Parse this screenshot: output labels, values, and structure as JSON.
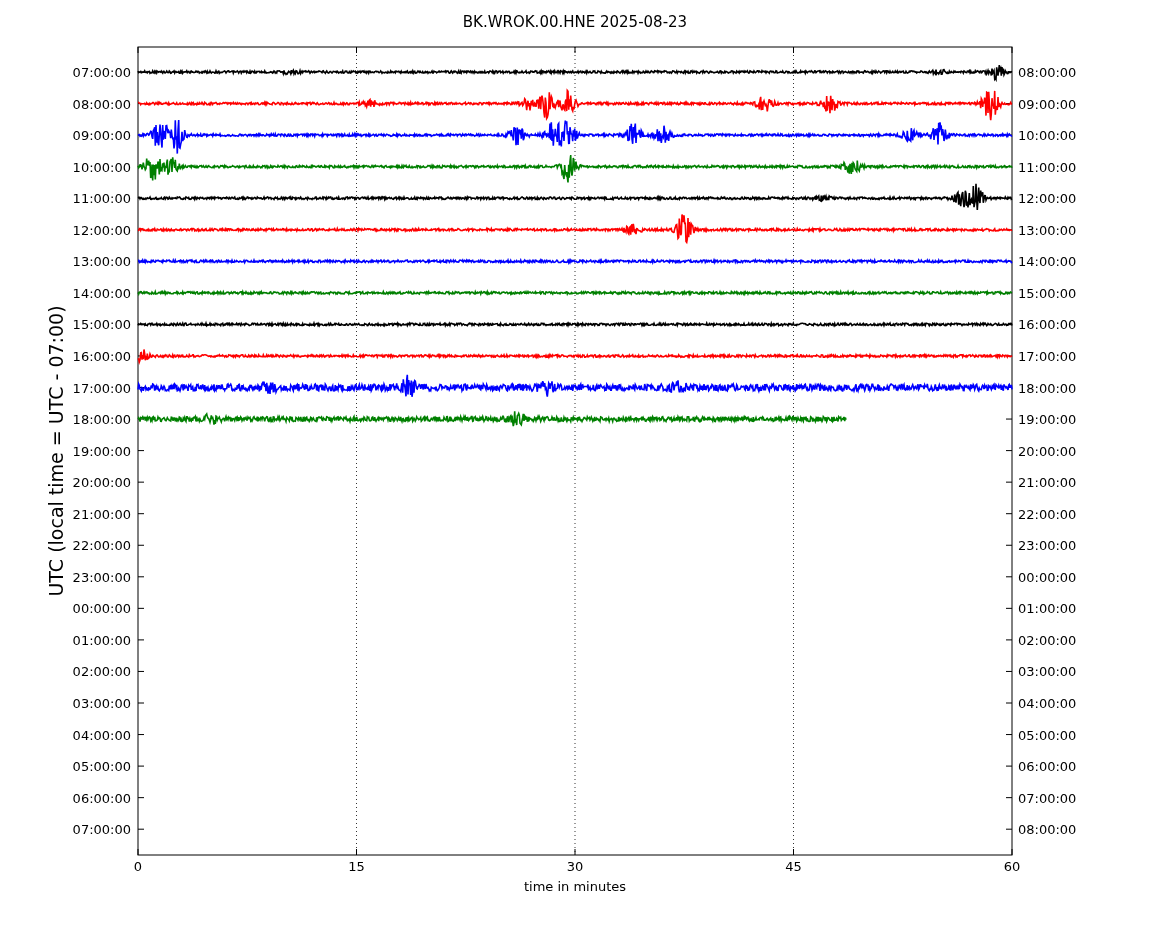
{
  "title": "BK.WROK.00.HNE 2025-08-23",
  "ylabel": "UTC (local time = UTC - 07:00)",
  "xlabel": "time in minutes",
  "xticks": [
    "0",
    "15",
    "30",
    "45",
    "60"
  ],
  "left_labels": [
    "07:00:00",
    "08:00:00",
    "09:00:00",
    "10:00:00",
    "11:00:00",
    "12:00:00",
    "13:00:00",
    "14:00:00",
    "15:00:00",
    "16:00:00",
    "17:00:00",
    "18:00:00",
    "19:00:00",
    "20:00:00",
    "21:00:00",
    "22:00:00",
    "23:00:00",
    "00:00:00",
    "01:00:00",
    "02:00:00",
    "03:00:00",
    "04:00:00",
    "05:00:00",
    "06:00:00",
    "07:00:00"
  ],
  "right_labels": [
    "08:00:00",
    "09:00:00",
    "10:00:00",
    "11:00:00",
    "12:00:00",
    "13:00:00",
    "14:00:00",
    "15:00:00",
    "16:00:00",
    "17:00:00",
    "18:00:00",
    "19:00:00",
    "20:00:00",
    "21:00:00",
    "22:00:00",
    "23:00:00",
    "00:00:00",
    "01:00:00",
    "02:00:00",
    "03:00:00",
    "04:00:00",
    "05:00:00",
    "06:00:00",
    "07:00:00",
    "08:00:00"
  ],
  "traces": [
    {
      "color": "#000000",
      "complete": true
    },
    {
      "color": "#ff0000",
      "complete": true
    },
    {
      "color": "#0000ff",
      "complete": true
    },
    {
      "color": "#008000",
      "complete": true
    },
    {
      "color": "#000000",
      "complete": true
    },
    {
      "color": "#ff0000",
      "complete": true
    },
    {
      "color": "#0000ff",
      "complete": true
    },
    {
      "color": "#008000",
      "complete": true
    },
    {
      "color": "#000000",
      "complete": true
    },
    {
      "color": "#ff0000",
      "complete": true
    },
    {
      "color": "#0000ff",
      "complete": true
    },
    {
      "color": "#008000",
      "complete": false
    }
  ]
}
